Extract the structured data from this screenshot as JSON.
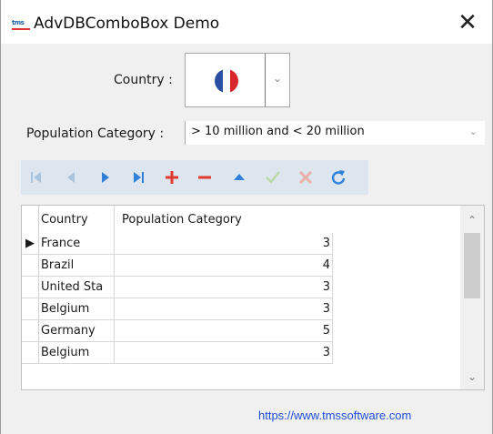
{
  "window": {
    "title": "AdvDBComboBox Demo",
    "logo_text": "tms",
    "close_glyph": "✕"
  },
  "country": {
    "label": "Country :",
    "selected_icon": "france-flag-icon",
    "dropdown_glyph": "⌄"
  },
  "population": {
    "label": "Population Category :",
    "value": "> 10 million and < 20 million",
    "dropdown_glyph": "⌄"
  },
  "navigator": {
    "buttons": [
      {
        "name": "first-record-button",
        "icon": "first-record-icon",
        "enabled": false
      },
      {
        "name": "prior-record-button",
        "icon": "prior-record-icon",
        "enabled": false
      },
      {
        "name": "next-record-button",
        "icon": "next-record-icon",
        "enabled": true
      },
      {
        "name": "last-record-button",
        "icon": "last-record-icon",
        "enabled": true
      },
      {
        "name": "insert-button",
        "icon": "plus-icon",
        "enabled": true
      },
      {
        "name": "delete-button",
        "icon": "minus-icon",
        "enabled": true
      },
      {
        "name": "edit-button",
        "icon": "edit-icon",
        "enabled": true
      },
      {
        "name": "post-button",
        "icon": "check-icon",
        "enabled": false
      },
      {
        "name": "cancel-button",
        "icon": "cancel-icon",
        "enabled": false
      },
      {
        "name": "refresh-button",
        "icon": "refresh-icon",
        "enabled": true
      }
    ]
  },
  "grid": {
    "columns": [
      "Country",
      "Population Category"
    ],
    "rows": [
      {
        "country": "France",
        "category": "3",
        "current": true
      },
      {
        "country": "Brazil",
        "category": "4",
        "current": false
      },
      {
        "country": "United Sta",
        "category": "3",
        "current": false
      },
      {
        "country": "Belgium",
        "category": "3",
        "current": false
      },
      {
        "country": "Germany",
        "category": "5",
        "current": false
      },
      {
        "country": "Belgium",
        "category": "3",
        "current": false
      }
    ],
    "indicator_glyph": "▶",
    "scroll_up_glyph": "⌃",
    "scroll_down_glyph": "⌄"
  },
  "footer": {
    "link_text": "https://www.tmssoftware.com"
  },
  "colors": {
    "nav_blue": "#2f80d6",
    "nav_disabled": "#a9c3dc",
    "nav_red": "#e03a2f",
    "nav_disabled_red": "#eab0a8",
    "nav_check_disabled": "#b9d9a6",
    "link": "#1f4fd6",
    "flag_blue": "#2a4ea2",
    "flag_white": "#ffffff",
    "flag_red": "#d8262d"
  }
}
